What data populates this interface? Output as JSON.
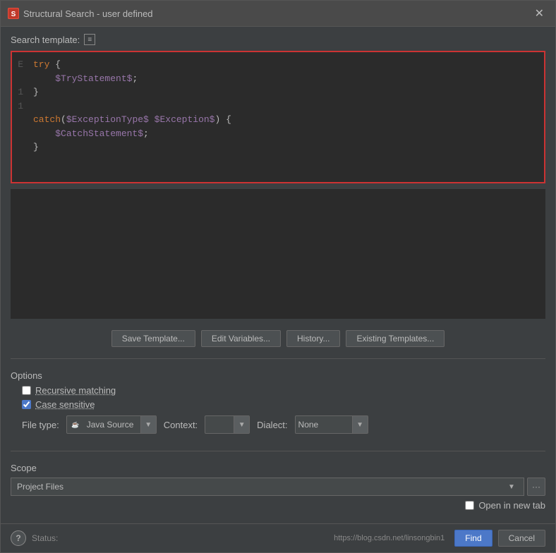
{
  "title": {
    "text": "Structural Search - user defined",
    "icon": "S"
  },
  "search_template": {
    "label": "Search template:",
    "icon": "≡"
  },
  "code": {
    "lines": [
      {
        "num": "",
        "content": "try {",
        "type": "mixed"
      },
      {
        "num": "",
        "content": "    $TryStatement$;",
        "type": "var"
      },
      {
        "num": "",
        "content": "}",
        "type": "punc"
      },
      {
        "num": "",
        "content": "",
        "type": "empty"
      },
      {
        "num": "",
        "content": "catch($ExceptionType$ $Exception$) {",
        "type": "catch"
      },
      {
        "num": "",
        "content": "    $CatchStatement$;",
        "type": "var"
      },
      {
        "num": "",
        "content": "}",
        "type": "punc"
      }
    ]
  },
  "toolbar": {
    "save_template": "Save Template...",
    "edit_variables": "Edit Variables...",
    "history": "History...",
    "existing_templates": "Existing Templates..."
  },
  "options": {
    "label": "Options",
    "recursive_matching": "Recursive matching",
    "case_sensitive": "Case sensitive",
    "file_type_label": "File type:",
    "file_type_value": "Java Source",
    "context_label": "Context:",
    "context_value": "",
    "dialect_label": "Dialect:",
    "dialect_value": "None"
  },
  "scope": {
    "label": "Scope",
    "value": "Project Files",
    "open_new_tab": "Open in new tab"
  },
  "status": {
    "label": "Status:"
  },
  "url": "https://blog.csdn.net/linsongbin1",
  "buttons": {
    "find": "Find",
    "cancel": "Cancel"
  }
}
